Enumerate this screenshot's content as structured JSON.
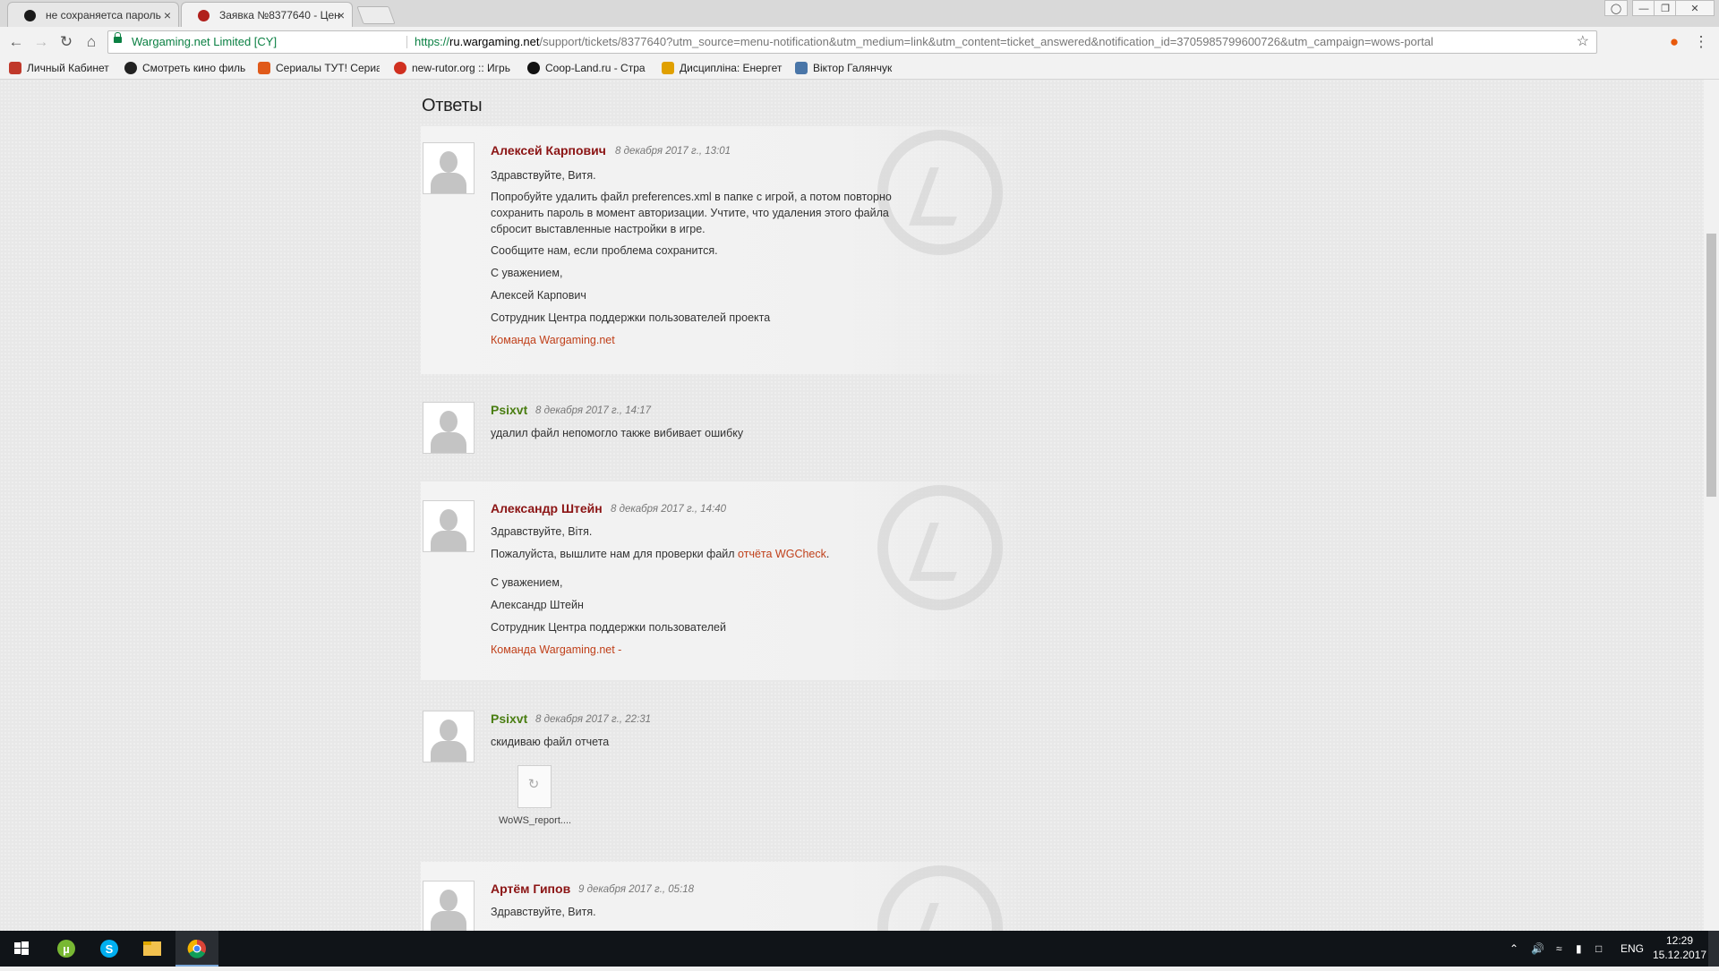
{
  "browser": {
    "tabs": [
      {
        "title": "не сохраняетса пароль",
        "favicon_color": "#1a1a1a"
      },
      {
        "title": "Заявка №8377640 - Цен",
        "favicon_color": "#b0201c"
      }
    ],
    "window_controls": {
      "user_icon": "user-icon",
      "minimize": "minimize-icon",
      "restore": "restore-icon",
      "close": "close-icon"
    },
    "address": {
      "secure_label": "Wargaming.net Limited [CY]",
      "url_proto": "https://",
      "url_host": "ru.wargaming.net",
      "url_rest": "/support/tickets/8377640?utm_source=menu-notification&utm_medium=link&utm_content=ticket_answered&notification_id=3705985799600726&utm_campaign=wows-portal"
    },
    "nav_icons": [
      "back-arrow-icon",
      "forward-arrow-icon",
      "reload-icon",
      "home-icon"
    ],
    "bookmarks": [
      {
        "label": "Личный Кабинет",
        "icon_color": "#c0392b"
      },
      {
        "label": "Смотреть кино филь",
        "icon_color": "#222222"
      },
      {
        "label": "Сериалы ТУТ! Сериа",
        "icon_color": "#e05a1a"
      },
      {
        "label": "new-rutor.org :: Игрь",
        "icon_color": "#d03020"
      },
      {
        "label": "Coop-Land.ru - Стра",
        "icon_color": "#111111"
      },
      {
        "label": "Дисципліна: Енергет",
        "icon_color": "#e0a000"
      },
      {
        "label": "Віктор Галянчук",
        "icon_color": "#4a76a8"
      }
    ]
  },
  "page": {
    "heading": "Ответы",
    "replies": [
      {
        "role": "staff",
        "author": "Алексей Карпович",
        "date": "8 декабря 2017 г., 13:01",
        "lines": [
          "Здравствуйте, Витя.",
          "Попробуйте удалить файл preferences.xml в папке с игрой, а потом повторно",
          "сохранить пароль в момент авторизации. Учтите, что удаления этого файла",
          "сбросит выставленные настройки в игре.",
          "Сообщите нам, если проблема сохранится.",
          "С уважением,",
          "Алексей Карпович",
          "Сотрудник Центра поддержки пользователей проекта"
        ],
        "signature_link": "Команда Wargaming.net"
      },
      {
        "role": "user",
        "author": "Psixvt",
        "date": "8 декабря 2017 г., 14:17",
        "lines": [
          "удалил файл непомогло также вибивает ошибку"
        ]
      },
      {
        "role": "staff",
        "author": "Александр Штейн",
        "date": "8 декабря 2017 г., 14:40",
        "lines": [
          "Здравствуйте, Вітя.",
          "Пожалуйста, вышлите нам для проверки файл ",
          "С уважением,",
          "Александр Штейн",
          "Сотрудник Центра поддержки пользователей"
        ],
        "inline_link": "отчёта WGCheck",
        "inline_after": ".",
        "signature_link": "Команда Wargaming.net",
        "signature_suffix": " -"
      },
      {
        "role": "user",
        "author": "Psixvt",
        "date": "8 декабря 2017 г., 22:31",
        "lines": [
          "скидиваю файл отчета"
        ],
        "attachment": "WoWS_report...."
      },
      {
        "role": "staff",
        "author": "Артём Гипов",
        "date": "9 декабря 2017 г., 05:18",
        "lines": [
          "Здравствуйте, Витя."
        ]
      }
    ]
  },
  "taskbar": {
    "apps": [
      {
        "name": "windows-start-icon"
      },
      {
        "name": "utorrent-icon",
        "color": "#78b833"
      },
      {
        "name": "skype-icon",
        "color": "#00aff0"
      },
      {
        "name": "file-explorer-icon",
        "color": "#f2c14e"
      },
      {
        "name": "chrome-icon",
        "color": "#db4437"
      }
    ],
    "language": "ENG",
    "time": "12:29",
    "date": "15.12.2017"
  }
}
